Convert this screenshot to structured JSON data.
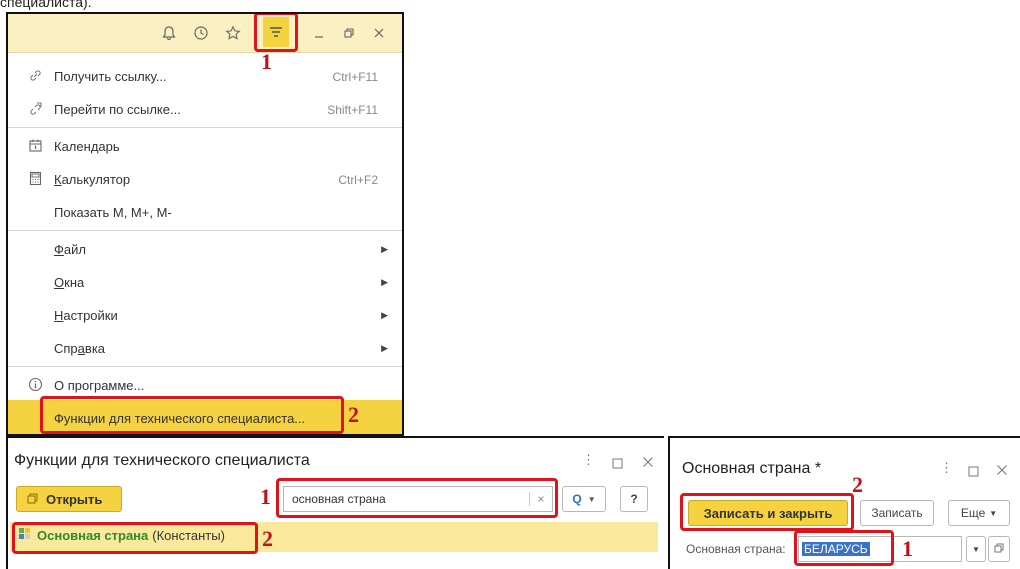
{
  "caption": "специалиста).",
  "menu": {
    "items": [
      {
        "icon": "link-icon",
        "label": "Получить ссылку...",
        "shortcut": "Ctrl+F11"
      },
      {
        "icon": "follow-link-icon",
        "label": "Перейти по ссылке...",
        "shortcut": "Shift+F11"
      },
      {
        "icon": "calendar-icon",
        "label_pre": "Кален",
        "label_u": "д",
        "label_post": "арь",
        "shortcut": ""
      },
      {
        "icon": "calculator-icon",
        "label_pre": "",
        "label_u": "К",
        "label_post": "алькулятор",
        "shortcut": "Ctrl+F2"
      },
      {
        "icon": "",
        "label": "Показать M, M+, M-",
        "shortcut": ""
      },
      {
        "label_pre": "",
        "label_u": "Ф",
        "label_post": "айл"
      },
      {
        "label_pre": "",
        "label_u": "О",
        "label_post": "кна"
      },
      {
        "label_pre": "",
        "label_u": "Н",
        "label_post": "астройки"
      },
      {
        "label_pre": "Спр",
        "label_u": "а",
        "label_post": "вка"
      },
      {
        "icon": "info-icon",
        "label": "О программе..."
      },
      {
        "label": "Функции для технического специалиста..."
      }
    ]
  },
  "annotations": {
    "one": "1",
    "two": "2"
  },
  "window_functions": {
    "title": "Функции для технического специалиста",
    "open_button": "Открыть",
    "search_value": "основная страна",
    "clear_glyph": "×",
    "search_glyph": "Q",
    "help_glyph": "?",
    "result_name": "Основная страна",
    "result_type": "(Константы)"
  },
  "window_constant": {
    "title": "Основная страна *",
    "save_close_button": "Записать и закрыть",
    "save_button": "Записать",
    "more_button": "Еще",
    "field_label": "Основная страна:",
    "field_value": "БЕЛАРУСЬ"
  },
  "colors": {
    "accent_yellow": "#f5d23f",
    "highlight_red": "#e0131c",
    "link_green": "#2e8b2e",
    "selection_blue": "#3a72c8"
  }
}
